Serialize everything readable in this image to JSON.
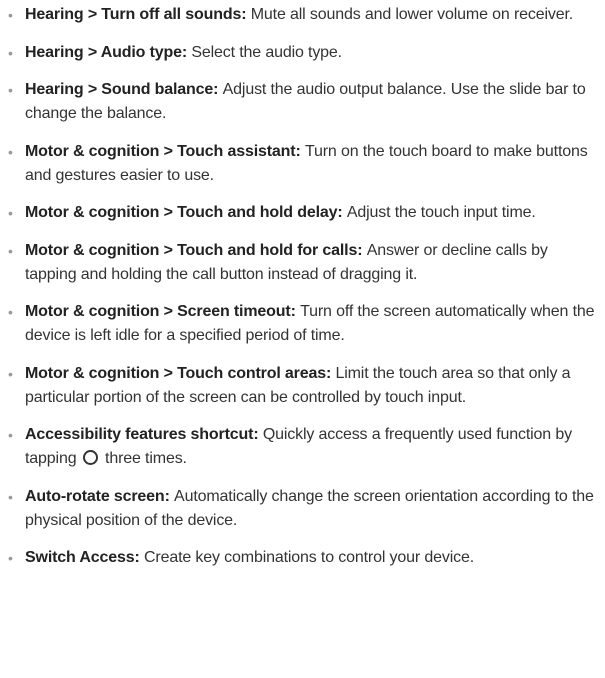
{
  "items": [
    {
      "term": "Hearing > Turn off all sounds",
      "desc": "Mute all sounds and lower volume on receiver."
    },
    {
      "term": "Hearing > Audio type",
      "desc": "Select the audio type."
    },
    {
      "term": "Hearing > Sound balance",
      "desc": "Adjust the audio output balance. Use the slide bar to change the balance."
    },
    {
      "term": "Motor & cognition > Touch assistant",
      "desc": "Turn on the touch board to make buttons and gestures easier to use."
    },
    {
      "term": "Motor & cognition > Touch and hold delay",
      "desc": "Adjust the touch input time."
    },
    {
      "term": "Motor & cognition > Touch and hold for calls",
      "desc": "Answer or decline calls by tapping and holding the call button instead of dragging it."
    },
    {
      "term": "Motor & cognition > Screen timeout",
      "desc": "Turn off the screen automatically when the device is left idle for a specified period of time."
    },
    {
      "term": "Motor & cognition > Touch control areas",
      "desc": "Limit the touch area so that only a particular portion of the screen can be controlled by touch input."
    },
    {
      "term": "Accessibility features shortcut",
      "desc_before": "Quickly access a frequently used function by tapping",
      "desc_icon": "home-button-icon",
      "desc_after": "three times."
    },
    {
      "term": "Auto-rotate screen",
      "desc": "Automatically change the screen orientation according to the physical position of the device."
    },
    {
      "term": "Switch Access",
      "desc": "Create key combinations to control your device."
    }
  ],
  "separator": ": ",
  "bullet": "•"
}
